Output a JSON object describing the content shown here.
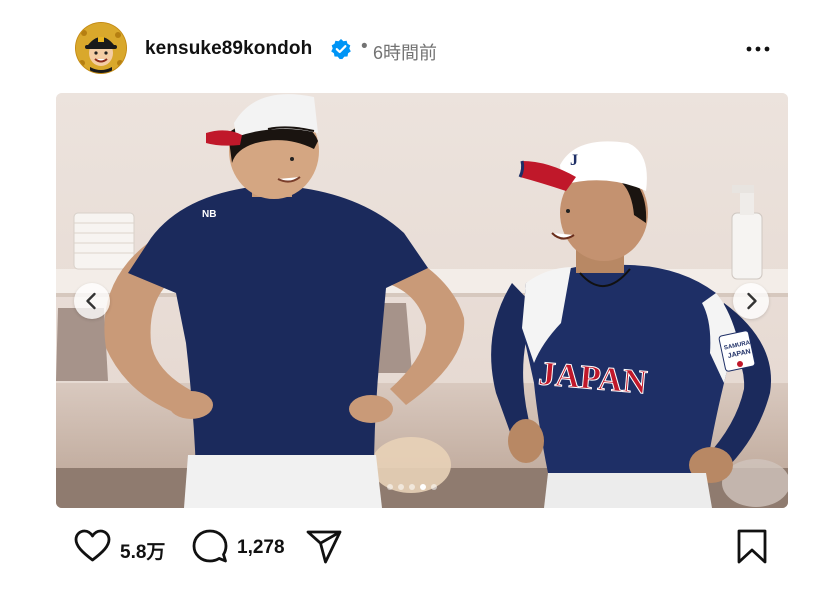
{
  "post": {
    "username": "kensuke89kondoh",
    "separator": "•",
    "time": "6時間前",
    "likes": "5.8万",
    "comments": "1,278"
  },
  "media": {
    "jersey_text": "JAPAN",
    "patch_line1": "SAMURAI",
    "patch_line2": "JAPAN",
    "cap_letter": "J",
    "slide_count": 5,
    "active_slide": 4
  },
  "icons": {
    "verified": "verified-badge-icon",
    "more": "more-options-icon",
    "like": "heart-icon",
    "comment": "comment-bubble-icon",
    "share": "paper-plane-icon",
    "save": "bookmark-icon",
    "prev": "chevron-left-icon",
    "next": "chevron-right-icon"
  },
  "colors": {
    "verified_blue": "#0095f6",
    "secondary_text": "#737373",
    "navy_shirt": "#1b2a5c",
    "jersey_red": "#c0182a"
  }
}
